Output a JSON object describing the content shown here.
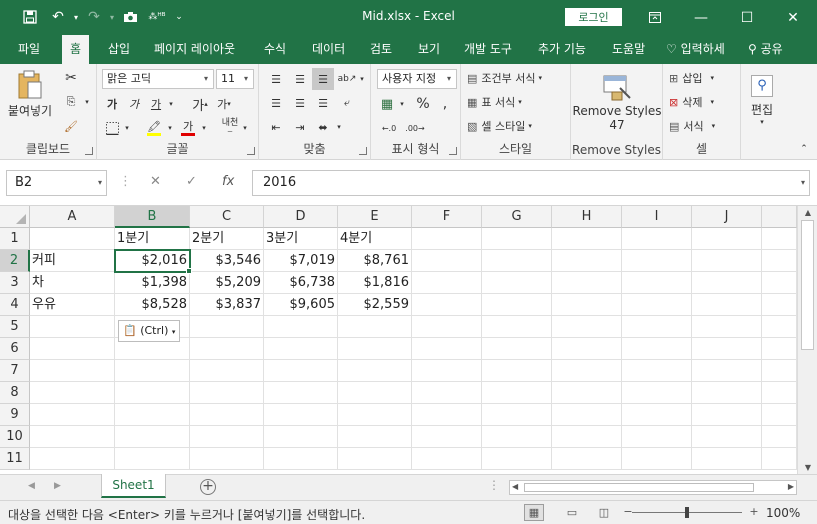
{
  "titlebar": {
    "save_icon": "save-icon",
    "undo_icon": "undo-icon",
    "redo_icon": "redo-icon",
    "camera_icon": "camera-icon",
    "custom_qat_label": "⁂ᴴᴮ",
    "doc_title": "Mid.xlsx  -  Excel",
    "login_label": "로그인",
    "brand_color": "#217346"
  },
  "tabs": {
    "items": [
      "파일",
      "홈",
      "삽입",
      "페이지 레이아웃",
      "수식",
      "데이터",
      "검토",
      "보기",
      "개발 도구",
      "추가 기능",
      "도움말"
    ],
    "active": "홈",
    "tell_me": "입력하세",
    "share": "공유"
  },
  "ribbon": {
    "clipboard": {
      "label": "클립보드",
      "paste_label": "붙여넣기"
    },
    "font": {
      "label": "글꼴",
      "font_name": "맑은 고딕",
      "font_size": "11"
    },
    "alignment": {
      "label": "맞춤"
    },
    "number": {
      "label": "표시 형식",
      "format": "사용자 지정"
    },
    "styles": {
      "label": "스타일",
      "conditional": "조건부 서식",
      "table": "표 서식",
      "cell": "셀 스타일"
    },
    "remove_styles": {
      "label": "Remove Styles",
      "btn_line1": "Remove Styles",
      "btn_line2": "47"
    },
    "cells": {
      "label": "셀",
      "insert": "삽입",
      "delete": "삭제",
      "format": "서식"
    },
    "editing": {
      "label": "편집"
    }
  },
  "formula_bar": {
    "name_box": "B2",
    "cancel_icon": "✕",
    "enter_icon": "✓",
    "fx_label": "fx",
    "formula": "2016"
  },
  "grid": {
    "columns": [
      "A",
      "B",
      "C",
      "D",
      "E",
      "F",
      "G",
      "H",
      "I",
      "J"
    ],
    "rows": [
      "1",
      "2",
      "3",
      "4",
      "5",
      "6",
      "7",
      "8",
      "9",
      "10",
      "11"
    ],
    "data": [
      [
        "",
        "1분기",
        "2분기",
        "3분기",
        "4분기"
      ],
      [
        "커피",
        "$2,016",
        "$3,546",
        "$7,019",
        "$8,761"
      ],
      [
        "차",
        "$1,398",
        "$5,209",
        "$6,738",
        "$1,816"
      ],
      [
        "우유",
        "$8,528",
        "$3,837",
        "$9,605",
        "$2,559"
      ]
    ],
    "active_cell": "B2",
    "paste_options_label": "(Ctrl)"
  },
  "sheets": {
    "tabs": [
      "Sheet1"
    ],
    "active": "Sheet1"
  },
  "status": {
    "message": "대상을 선택한 다음 <Enter> 키를 누르거나 [붙여넣기]를 선택합니다.",
    "zoom": "100%"
  }
}
